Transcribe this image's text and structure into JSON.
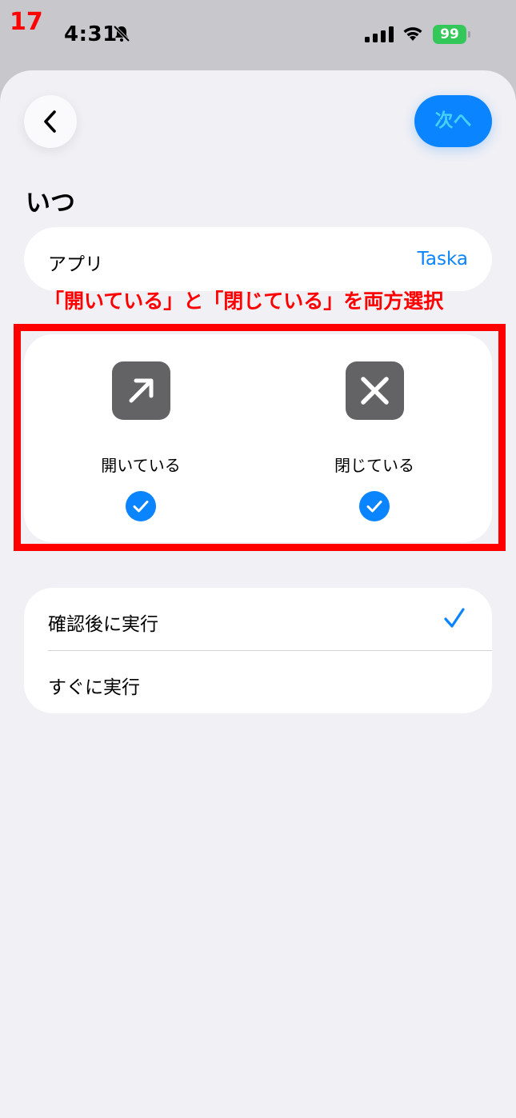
{
  "step_number": "17",
  "status_bar": {
    "time": "4:31",
    "battery_level": "99",
    "battery_color": "#34c759",
    "icons": [
      "bell-slash-icon",
      "cellular-signal-icon",
      "wifi-icon",
      "battery-charging-icon"
    ]
  },
  "nav": {
    "back_icon": "chevron-left-icon",
    "next_label": "次へ"
  },
  "section_title": "いつ",
  "app_row": {
    "label": "アプリ",
    "value": "Taska"
  },
  "annotation": "「開いている」と「閉じている」を両方選択",
  "states": [
    {
      "label": "開いている",
      "icon": "arrow-up-right-icon",
      "selected": true
    },
    {
      "label": "閉じている",
      "icon": "x-mark-icon",
      "selected": true
    }
  ],
  "run_options": [
    {
      "label": "確認後に実行",
      "selected": true
    },
    {
      "label": "すぐに実行",
      "selected": false
    }
  ],
  "colors": {
    "accent": "#0a84ff",
    "annotation": "#ff0000",
    "sheet_background": "#f0f0f5",
    "icon_tile": "#636366"
  }
}
